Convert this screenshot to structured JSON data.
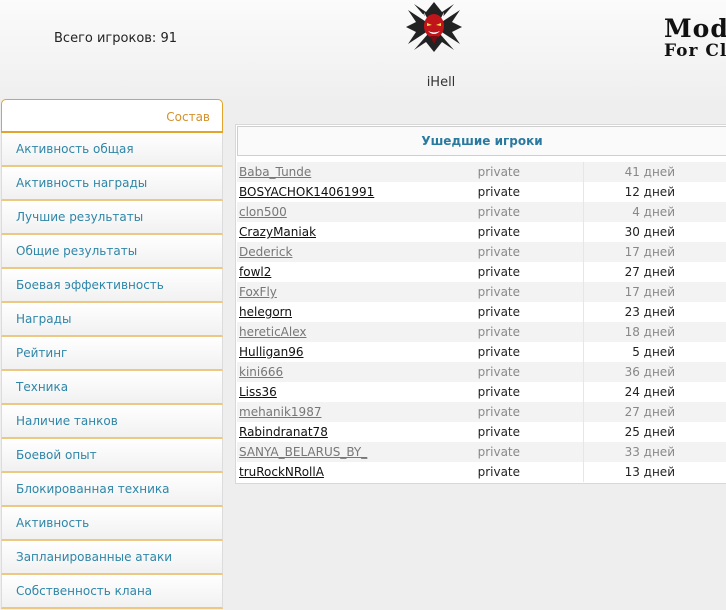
{
  "header": {
    "player_count": "Всего игроков: 91",
    "clan_name": "iHell",
    "brand_line1": "Modu",
    "brand_line2": "For Cla",
    "emblem": "devil-emblem-icon"
  },
  "sidebar": {
    "title": "Состав",
    "items": [
      "Активность общая",
      "Активность награды",
      "Лучшие результаты",
      "Общие результаты",
      "Боевая эффективность",
      "Награды",
      "Рейтинг",
      "Техника",
      "Наличие танков",
      "Боевой опыт",
      "Блокированная техника",
      "Активность",
      "Запланированные атаки",
      "Собственность клана"
    ]
  },
  "panel": {
    "title": "Ушедшие игроки",
    "rows": [
      {
        "name": "Baba_Tunde",
        "type": "private",
        "days": "41 дней"
      },
      {
        "name": "BOSYACHOK14061991",
        "type": "private",
        "days": "12 дней"
      },
      {
        "name": "clon500",
        "type": "private",
        "days": "4 дней"
      },
      {
        "name": "CrazyManiak",
        "type": "private",
        "days": "30 дней"
      },
      {
        "name": "Dederick",
        "type": "private",
        "days": "17 дней"
      },
      {
        "name": "fowl2",
        "type": "private",
        "days": "27 дней"
      },
      {
        "name": "FoxFly",
        "type": "private",
        "days": "17 дней"
      },
      {
        "name": "helegorn",
        "type": "private",
        "days": "23 дней"
      },
      {
        "name": "hereticAlex",
        "type": "private",
        "days": "18 дней"
      },
      {
        "name": "Hulligan96",
        "type": "private",
        "days": "5 дней"
      },
      {
        "name": "kini666",
        "type": "private",
        "days": "36 дней"
      },
      {
        "name": "Liss36",
        "type": "private",
        "days": "24 дней"
      },
      {
        "name": "mehanik1987",
        "type": "private",
        "days": "27 дней"
      },
      {
        "name": "Rabindranat78",
        "type": "private",
        "days": "25 дней"
      },
      {
        "name": "SANYA_BELARUS_BY_",
        "type": "private",
        "days": "33 дней"
      },
      {
        "name": "truRockNRollA",
        "type": "private",
        "days": "13 дней"
      }
    ]
  },
  "colors": {
    "accent_orange": "#e2a42a",
    "link_blue": "#2f86a8",
    "title_blue": "#2a7aa0",
    "emblem_red": "#c0141b"
  }
}
